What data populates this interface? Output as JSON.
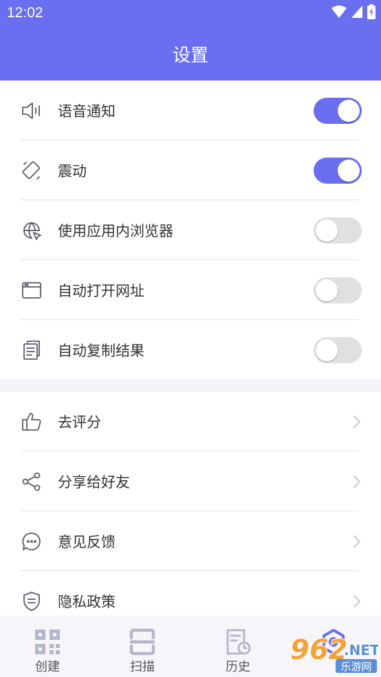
{
  "status_bar": {
    "time": "12:02"
  },
  "header": {
    "title": "设置"
  },
  "settings_toggles": [
    {
      "label": "语音通知",
      "icon": "speaker-icon",
      "on": true
    },
    {
      "label": "震动",
      "icon": "vibrate-icon",
      "on": true
    },
    {
      "label": "使用应用内浏览器",
      "icon": "globe-cursor-icon",
      "on": false
    },
    {
      "label": "自动打开网址",
      "icon": "browser-window-icon",
      "on": false
    },
    {
      "label": "自动复制结果",
      "icon": "copy-document-icon",
      "on": false
    }
  ],
  "settings_links": [
    {
      "label": "去评分",
      "icon": "thumbs-up-icon"
    },
    {
      "label": "分享给好友",
      "icon": "share-icon"
    },
    {
      "label": "意见反馈",
      "icon": "chat-bubble-icon"
    },
    {
      "label": "隐私政策",
      "icon": "shield-icon"
    }
  ],
  "bottom_nav": [
    {
      "label": "创建",
      "icon": "qr-code-icon"
    },
    {
      "label": "扫描",
      "icon": "scan-icon"
    },
    {
      "label": "历史",
      "icon": "history-icon"
    }
  ],
  "watermark": {
    "text": "962",
    "suffix": ".NET",
    "caption": "乐游网"
  },
  "colors": {
    "accent": "#6a6ef0",
    "toggle_off": "#e0e0e3",
    "text": "#333333",
    "icon": "#5a5a66"
  }
}
